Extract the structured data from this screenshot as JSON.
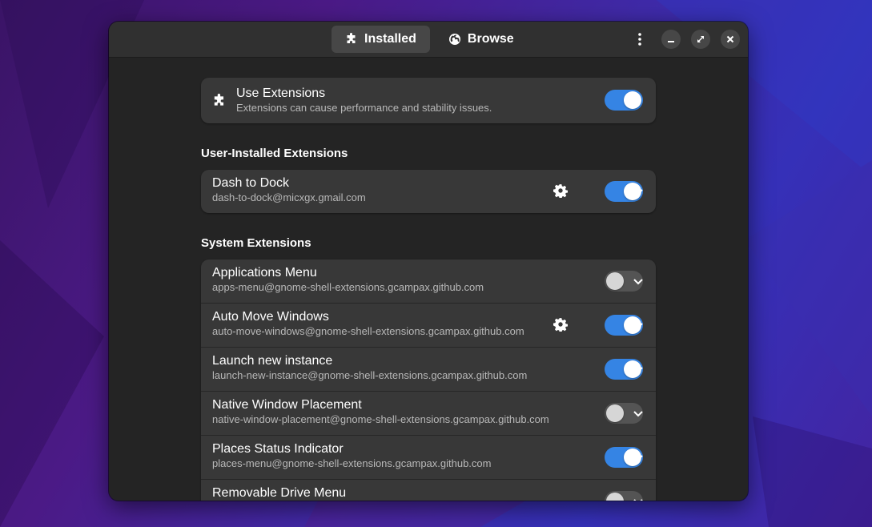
{
  "tabs": [
    {
      "label": "Installed",
      "icon": "puzzle-icon",
      "active": true
    },
    {
      "label": "Browse",
      "icon": "globe-icon",
      "active": false
    }
  ],
  "window_controls": [
    "kebab-menu-icon",
    "minimize-icon",
    "maximize-icon",
    "close-icon"
  ],
  "use_extensions": {
    "title": "Use Extensions",
    "subtitle": "Extensions can cause performance and stability issues.",
    "enabled": true
  },
  "user_section": {
    "title": "User-Installed Extensions",
    "items": [
      {
        "name": "Dash to Dock",
        "uuid": "dash-to-dock@micxgx.gmail.com",
        "enabled": true,
        "has_settings": true
      }
    ]
  },
  "system_section": {
    "title": "System Extensions",
    "items": [
      {
        "name": "Applications Menu",
        "uuid": "apps-menu@gnome-shell-extensions.gcampax.github.com",
        "enabled": false,
        "has_settings": false
      },
      {
        "name": "Auto Move Windows",
        "uuid": "auto-move-windows@gnome-shell-extensions.gcampax.github.com",
        "enabled": true,
        "has_settings": true
      },
      {
        "name": "Launch new instance",
        "uuid": "launch-new-instance@gnome-shell-extensions.gcampax.github.com",
        "enabled": true,
        "has_settings": false
      },
      {
        "name": "Native Window Placement",
        "uuid": "native-window-placement@gnome-shell-extensions.gcampax.github.com",
        "enabled": false,
        "has_settings": false
      },
      {
        "name": "Places Status Indicator",
        "uuid": "places-menu@gnome-shell-extensions.gcampax.github.com",
        "enabled": true,
        "has_settings": false
      },
      {
        "name": "Removable Drive Menu",
        "uuid": "",
        "enabled": false,
        "has_settings": false
      }
    ]
  },
  "colors": {
    "accent": "#3584e4",
    "window_bg": "#242424",
    "card_bg": "#383838"
  }
}
